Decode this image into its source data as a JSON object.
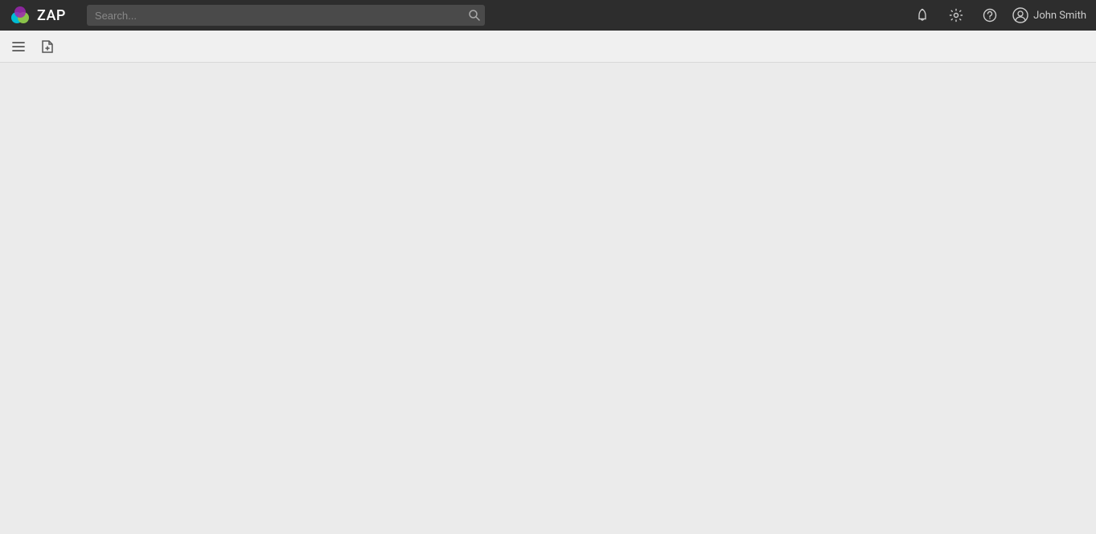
{
  "app": {
    "title": "ZAP",
    "logo_alt": "ZAP Logo"
  },
  "navbar": {
    "search_placeholder": "Search...",
    "user_name": "John Smith",
    "icons": {
      "bell": "bell-icon",
      "settings": "settings-icon",
      "help": "help-icon",
      "user": "user-icon",
      "menu": "menu-icon",
      "new_file": "new-file-icon"
    }
  },
  "toolbar": {
    "menu_label": "Menu",
    "new_file_label": "New File"
  },
  "main": {
    "background_color": "#ebebeb"
  }
}
